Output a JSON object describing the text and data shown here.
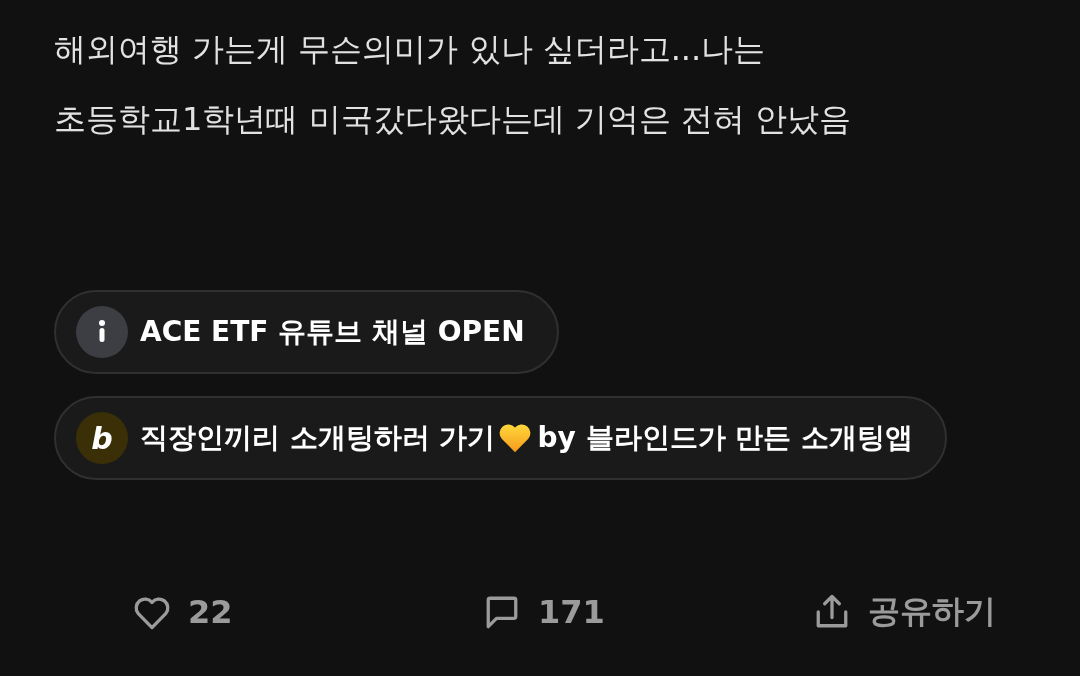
{
  "body_lines": [
    "해외여행 가는게 무슨의미가 있나 싶더라고...나는",
    "초등학교1학년때 미국갔다왔다는데 기억은 전혀 안났음"
  ],
  "links": [
    {
      "kind": "info",
      "text": "ACE ETF 유튜브 채널 OPEN"
    },
    {
      "kind": "brand",
      "logo_letter": "b",
      "text": "직장인끼리 소개팅하러 가기",
      "text_after": "by 블라인드가 만든 소개팅앱"
    }
  ],
  "actions": [
    {
      "kind": "like",
      "label": "22"
    },
    {
      "kind": "comment",
      "label": "171"
    },
    {
      "kind": "share",
      "label": "공유하기"
    }
  ]
}
